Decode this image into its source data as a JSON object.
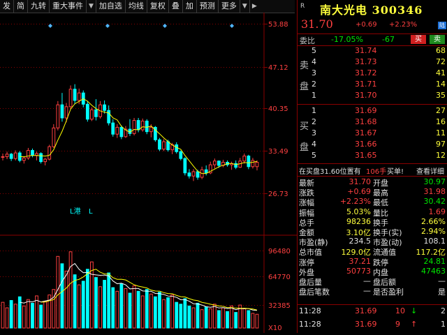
{
  "toolbar": {
    "buttons": [
      "发",
      "简",
      "九转",
      "重大事件",
      "加自选",
      "均线",
      "复权",
      "叠",
      "加",
      "预测",
      "更多"
    ]
  },
  "chart": {
    "price_axis": [
      "53.88",
      "47.12",
      "40.35",
      "33.49",
      "26.73"
    ],
    "volume_axis": [
      "96480",
      "64770",
      "32385"
    ],
    "volume_unit": "X10",
    "markers": [
      "L港",
      "L"
    ],
    "colors": {
      "up": "#ff4040",
      "down": "#00ffff",
      "ma": "#ffff00",
      "grid": "#8b0000"
    }
  },
  "chart_data": {
    "type": "candlestick",
    "ylim": [
      26.73,
      53.88
    ],
    "candles": [
      [
        32.5,
        33.1,
        32.0,
        32.6
      ],
      [
        32.6,
        33.4,
        32.2,
        33.0
      ],
      [
        33.0,
        33.2,
        31.9,
        32.3
      ],
      [
        32.3,
        33.6,
        32.0,
        33.2
      ],
      [
        33.2,
        33.5,
        31.7,
        32.0
      ],
      [
        32.0,
        32.6,
        31.5,
        32.4
      ],
      [
        32.4,
        34.0,
        32.1,
        33.6
      ],
      [
        33.6,
        33.9,
        32.5,
        32.8
      ],
      [
        32.8,
        33.4,
        32.0,
        33.1
      ],
      [
        33.1,
        33.3,
        31.5,
        31.8
      ],
      [
        31.8,
        32.4,
        31.2,
        32.2
      ],
      [
        32.2,
        34.5,
        32.0,
        34.2
      ],
      [
        34.2,
        37.8,
        34.0,
        37.2
      ],
      [
        37.2,
        41.5,
        36.8,
        40.9
      ],
      [
        40.9,
        42.8,
        38.2,
        38.8
      ],
      [
        38.8,
        41.2,
        38.1,
        40.6
      ],
      [
        40.6,
        44.0,
        40.2,
        43.4
      ],
      [
        43.4,
        44.2,
        41.0,
        41.6
      ],
      [
        41.6,
        43.5,
        41.0,
        42.8
      ],
      [
        42.8,
        43.2,
        40.5,
        41.0
      ],
      [
        41.0,
        41.5,
        38.2,
        38.6
      ],
      [
        38.6,
        40.5,
        38.3,
        40.1
      ],
      [
        40.1,
        41.8,
        38.4,
        39.0
      ],
      [
        39.0,
        41.5,
        38.7,
        40.9
      ],
      [
        40.9,
        41.6,
        39.5,
        40.0
      ],
      [
        40.0,
        40.8,
        37.6,
        38.0
      ],
      [
        38.0,
        38.6,
        35.8,
        36.2
      ],
      [
        36.2,
        37.8,
        35.6,
        37.3
      ],
      [
        37.3,
        37.6,
        35.4,
        35.8
      ],
      [
        35.8,
        37.5,
        35.6,
        37.0
      ],
      [
        37.0,
        38.6,
        35.9,
        36.3
      ],
      [
        36.3,
        38.8,
        36.0,
        38.4
      ],
      [
        38.4,
        38.8,
        36.5,
        36.9
      ],
      [
        36.9,
        38.7,
        36.6,
        38.3
      ],
      [
        38.3,
        38.6,
        36.2,
        36.6
      ],
      [
        36.6,
        37.8,
        35.7,
        37.3
      ],
      [
        37.3,
        37.5,
        35.0,
        35.3
      ],
      [
        35.3,
        35.6,
        33.5,
        33.8
      ],
      [
        33.8,
        35.4,
        33.5,
        35.0
      ],
      [
        35.0,
        35.3,
        33.4,
        33.7
      ],
      [
        33.7,
        34.8,
        33.0,
        34.5
      ],
      [
        34.5,
        34.9,
        33.1,
        33.4
      ],
      [
        33.4,
        33.6,
        32.0,
        32.3
      ],
      [
        32.3,
        32.5,
        29.6,
        30.0
      ],
      [
        30.0,
        30.6,
        29.1,
        29.5
      ],
      [
        29.5,
        30.6,
        28.7,
        30.2
      ],
      [
        30.2,
        30.5,
        28.9,
        29.3
      ],
      [
        29.3,
        31.0,
        29.0,
        30.5
      ],
      [
        30.5,
        31.2,
        29.6,
        30.0
      ],
      [
        30.0,
        31.8,
        29.8,
        31.3
      ],
      [
        31.3,
        32.3,
        30.7,
        31.9
      ],
      [
        31.9,
        32.0,
        30.8,
        31.2
      ],
      [
        31.2,
        32.1,
        30.9,
        31.7
      ],
      [
        31.7,
        32.0,
        31.0,
        31.3
      ],
      [
        31.3,
        31.8,
        30.5,
        31.5
      ],
      [
        31.5,
        32.0,
        30.6,
        30.9
      ],
      [
        30.9,
        32.4,
        30.8,
        31.9
      ],
      [
        31.9,
        33.1,
        31.5,
        32.7
      ],
      [
        32.7,
        32.9,
        30.6,
        31.0
      ],
      [
        31.0,
        32.4,
        30.7,
        32.0
      ],
      [
        31.0,
        32.0,
        30.4,
        31.7
      ]
    ],
    "volumes": [
      28000,
      22000,
      30000,
      26000,
      34000,
      24000,
      31000,
      27000,
      35000,
      25000,
      29000,
      36000,
      42000,
      78000,
      70000,
      62000,
      83000,
      58000,
      47000,
      51000,
      64000,
      72000,
      55000,
      45000,
      52000,
      60000,
      44000,
      40000,
      48000,
      43000,
      38000,
      46000,
      40000,
      35000,
      42000,
      37000,
      34000,
      39000,
      31000,
      33000,
      36000,
      28000,
      26000,
      32000,
      24000,
      22000,
      27000,
      20000,
      23000,
      21000,
      26000,
      19000,
      22000,
      18000,
      24000,
      17000,
      25000,
      21000,
      19000,
      16000,
      15000
    ],
    "vol_ylim": [
      0,
      96480
    ]
  },
  "quote": {
    "badge": "R",
    "title": "南大光电 300346",
    "price": "31.70",
    "change": "+0.69",
    "change_pct": "+2.23%",
    "lu": "陆",
    "weibi_label": "委比",
    "weibi_value": "-17.05%",
    "weicha_value": "-67",
    "buy_btn": "买",
    "sell_btn": "卖"
  },
  "sell_book": {
    "chars": [
      "卖",
      "盘"
    ],
    "rows": [
      {
        "level": "5",
        "price": "31.74",
        "vol": "68"
      },
      {
        "level": "4",
        "price": "31.73",
        "vol": "72"
      },
      {
        "level": "3",
        "price": "31.72",
        "vol": "41"
      },
      {
        "level": "2",
        "price": "31.71",
        "vol": "14"
      },
      {
        "level": "1",
        "price": "31.70",
        "vol": "35"
      }
    ]
  },
  "buy_book": {
    "chars": [
      "买",
      "盘"
    ],
    "rows": [
      {
        "level": "1",
        "price": "31.69",
        "vol": "27"
      },
      {
        "level": "2",
        "price": "31.68",
        "vol": "16"
      },
      {
        "level": "3",
        "price": "31.67",
        "vol": "11"
      },
      {
        "level": "4",
        "price": "31.66",
        "vol": "97"
      },
      {
        "level": "5",
        "price": "31.65",
        "vol": "12"
      }
    ]
  },
  "notice": {
    "prefix": "在买盘31.60位置有",
    "hands": "106手",
    "suffix": "买单!",
    "link": "查看详细"
  },
  "stats": [
    {
      "l1": "最新",
      "v1": "31.70",
      "c1": "red",
      "l2": "开盘",
      "v2": "30.97",
      "c2": "grn"
    },
    {
      "l1": "涨跌",
      "v1": "+0.69",
      "c1": "red",
      "l2": "最高",
      "v2": "31.98",
      "c2": "red"
    },
    {
      "l1": "涨幅",
      "v1": "+2.23%",
      "c1": "red",
      "l2": "最低",
      "v2": "30.42",
      "c2": "grn"
    },
    {
      "l1": "振幅",
      "v1": "5.03%",
      "c1": "yel",
      "l2": "量比",
      "v2": "1.69",
      "c2": "red"
    },
    {
      "l1": "总手",
      "v1": "98236",
      "c1": "yel",
      "l2": "换手",
      "v2": "2.66%",
      "c2": "yel"
    },
    {
      "l1": "金额",
      "v1": "3.10亿",
      "c1": "yel",
      "l2": "换手(实)",
      "v2": "2.94%",
      "c2": "yel"
    },
    {
      "l1": "市盈(静)",
      "v1": "234.5",
      "c1": "wht",
      "l2": "市盈(动)",
      "v2": "108.1",
      "c2": "wht"
    },
    {
      "l1": "总市值",
      "v1": "129.0亿",
      "c1": "yel",
      "l2": "流通值",
      "v2": "117.2亿",
      "c2": "yel"
    },
    {
      "l1": "涨停",
      "v1": "37.21",
      "c1": "red",
      "l2": "跌停",
      "v2": "24.81",
      "c2": "grn"
    },
    {
      "l1": "外盘",
      "v1": "50773",
      "c1": "red",
      "l2": "内盘",
      "v2": "47463",
      "c2": "grn"
    },
    {
      "l1": "盘后量",
      "v1": "—",
      "c1": "wht",
      "l2": "盘后额",
      "v2": "—",
      "c2": "wht"
    },
    {
      "l1": "盘后笔数",
      "v1": "—",
      "c1": "wht",
      "l2": "是否盈利",
      "v2": "是",
      "c2": "wht"
    }
  ],
  "trades": [
    {
      "time": "11:28",
      "price": "31.69",
      "vol": "10",
      "arrow": "↓",
      "count": "2"
    },
    {
      "time": "11:28",
      "price": "31.69",
      "vol": "9",
      "arrow": "↑",
      "count": "1"
    }
  ]
}
